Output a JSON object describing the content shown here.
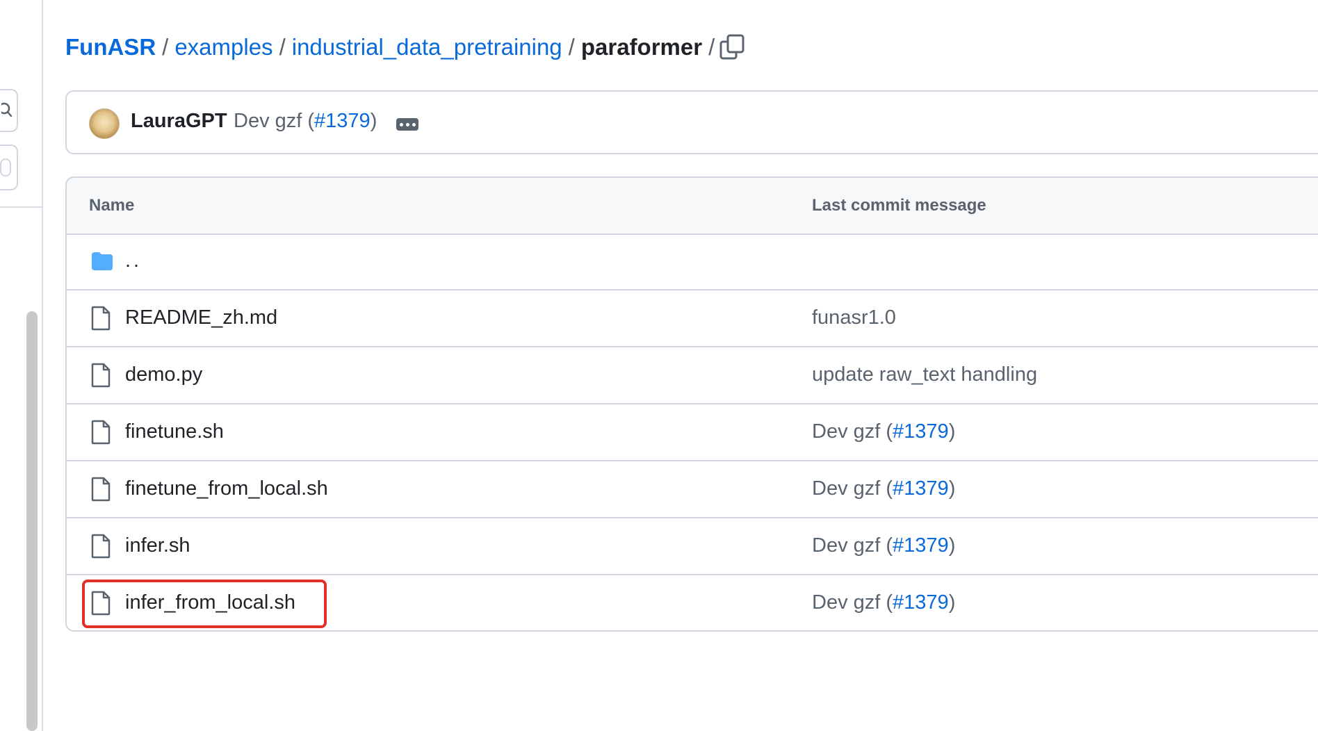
{
  "breadcrumb": {
    "items": [
      "FunASR",
      "examples",
      "industrial_data_pretraining"
    ],
    "current": "paraformer",
    "separator": "/"
  },
  "copy_icon": "copy-icon",
  "commit": {
    "author": "LauraGPT",
    "message_prefix": "Dev gzf (",
    "pr_link": "#1379",
    "message_suffix": ")"
  },
  "table": {
    "headers": {
      "name": "Name",
      "last_commit": "Last commit message"
    },
    "parent_dir": "..",
    "rows": [
      {
        "name": "README_zh.md",
        "msg": "funasr1.0",
        "pr": "",
        "msg_suffix": ""
      },
      {
        "name": "demo.py",
        "msg": "update raw_text handling",
        "pr": "",
        "msg_suffix": ""
      },
      {
        "name": "finetune.sh",
        "msg": "Dev gzf (",
        "pr": "#1379",
        "msg_suffix": ")"
      },
      {
        "name": "finetune_from_local.sh",
        "msg": "Dev gzf (",
        "pr": "#1379",
        "msg_suffix": ")"
      },
      {
        "name": "infer.sh",
        "msg": "Dev gzf (",
        "pr": "#1379",
        "msg_suffix": ")"
      },
      {
        "name": "infer_from_local.sh",
        "msg": "Dev gzf (",
        "pr": "#1379",
        "msg_suffix": ")"
      }
    ]
  },
  "colors": {
    "link": "#0969da",
    "muted": "#59636e",
    "highlight": "#e0302a",
    "folder": "#54aeff"
  }
}
